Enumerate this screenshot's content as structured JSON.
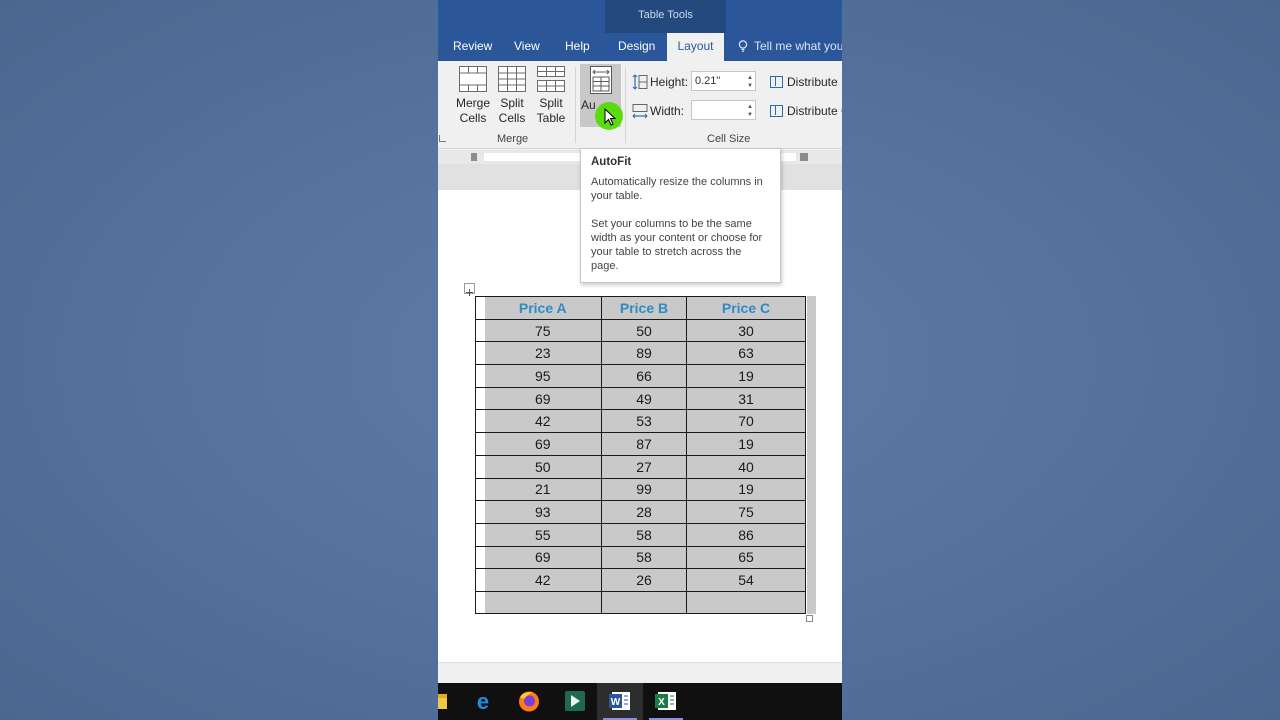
{
  "ribbon": {
    "context_tab": "Table Tools",
    "tabs": [
      {
        "label": "Review"
      },
      {
        "label": "View"
      },
      {
        "label": "Help"
      },
      {
        "label": "Design"
      },
      {
        "label": "Layout",
        "active": true
      }
    ],
    "tell_me": "Tell me what you",
    "merge_cells": "Merge Cells",
    "merge_cells_l1": "Merge",
    "merge_cells_l2": "Cells",
    "split_cells_l1": "Split",
    "split_cells_l2": "Cells",
    "split_table_l1": "Split",
    "split_table_l2": "Table",
    "autofit_partial": "Au",
    "merge_group": "Merge",
    "cell_size_group": "Cell Size",
    "height_label": "Height:",
    "height_value": "0.21\"",
    "width_label": "Width:",
    "width_value": "",
    "distribute_rows": "Distribute R",
    "distribute_cols": "Distribute C"
  },
  "tooltip": {
    "title": "AutoFit",
    "para1": "Automatically resize the columns in your table.",
    "para2": "Set your columns to be the same width as your content or choose for your table to stretch across the page."
  },
  "table": {
    "headers": [
      "Price A",
      "Price B",
      "Price C"
    ],
    "rows": [
      [
        "75",
        "50",
        "30"
      ],
      [
        "23",
        "89",
        "63"
      ],
      [
        "95",
        "66",
        "19"
      ],
      [
        "69",
        "49",
        "31"
      ],
      [
        "42",
        "53",
        "70"
      ],
      [
        "69",
        "87",
        "19"
      ],
      [
        "50",
        "27",
        "40"
      ],
      [
        "21",
        "99",
        "19"
      ],
      [
        "93",
        "28",
        "75"
      ],
      [
        "55",
        "58",
        "86"
      ],
      [
        "69",
        "58",
        "65"
      ],
      [
        "42",
        "26",
        "54"
      ],
      [
        "",
        "",
        ""
      ]
    ]
  },
  "taskbar": {
    "apps": [
      "file-explorer",
      "edge",
      "firefox",
      "app-green",
      "word",
      "excel"
    ]
  },
  "colors": {
    "word_blue": "#2b579a",
    "header_text": "#2e8bc6",
    "cell_fill": "#c9c9c9",
    "cursor_halo": "#50dc00"
  }
}
